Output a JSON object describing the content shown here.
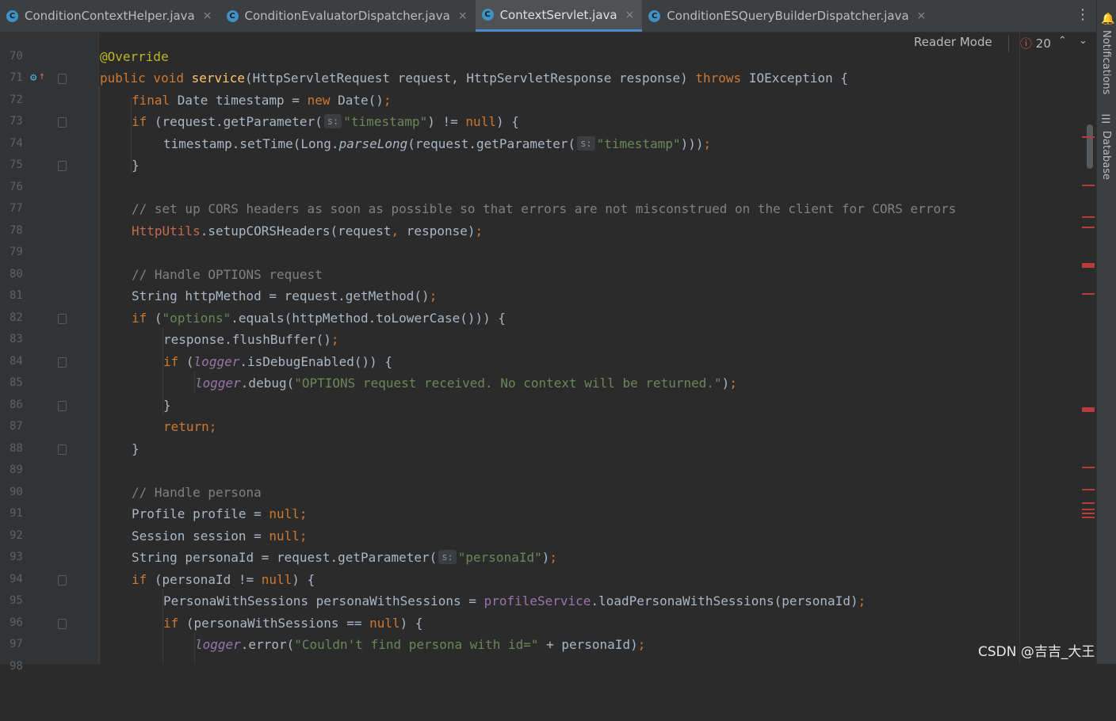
{
  "tabs": [
    {
      "label": "ConditionContextHelper.java",
      "icon": "class-c-icon",
      "active": false
    },
    {
      "label": "ConditionEvaluatorDispatcher.java",
      "icon": "class-c-icon",
      "active": false
    },
    {
      "label": "ContextServlet.java",
      "icon": "class-c-icon",
      "active": true
    },
    {
      "label": "ConditionESQueryBuilderDispatcher.java",
      "icon": "class-c-icon",
      "active": false
    }
  ],
  "tab_close_glyph": "×",
  "tab_icon_glyph": "C",
  "menu_glyph": "⋮",
  "toolbar": {
    "reader_mode": "Reader Mode",
    "error_count": "20",
    "error_glyph": "ⓘ",
    "up_glyph": "⌃",
    "down_glyph": "⌄"
  },
  "side_tools": {
    "notifications": "Notifications",
    "database": "Database"
  },
  "watermark": "CSDN @吉吉_大王",
  "colors": {
    "keyword": "#cc7832",
    "method": "#ffc66d",
    "string": "#6a8759",
    "comment": "#808080",
    "annotation": "#bbb529",
    "field": "#9876aa",
    "error_marker": "#b83b3b"
  },
  "code": {
    "l70": "70",
    "l71": "71",
    "l72": "72",
    "l73": "73",
    "l74": "74",
    "l75": "75",
    "l76": "76",
    "l77": "77",
    "l78": "78",
    "l79": "79",
    "l80": "80",
    "l81": "81",
    "l82": "82",
    "l83": "83",
    "l84": "84",
    "l85": "85",
    "l86": "86",
    "l87": "87",
    "l88": "88",
    "l89": "89",
    "l90": "90",
    "l91": "91",
    "l92": "92",
    "l93": "93",
    "l94": "94",
    "l95": "95",
    "l96": "96",
    "l97": "97",
    "l98": "98",
    "t71_a": "@Override",
    "t72_a": "public void ",
    "t72_b": "service",
    "t72_c": "(HttpServletRequest request, HttpServletResponse response) ",
    "t72_d": "throws ",
    "t72_e": "IOException {",
    "t73_a": "final ",
    "t73_b": "Date timestamp = ",
    "t73_c": "new ",
    "t73_d": "Date()",
    "t73_e": ";",
    "t74_a": "if ",
    "t74_b": "(request.getParameter(",
    "t74_hint": "s:",
    "t74_c": "\"timestamp\"",
    "t74_d": ") != ",
    "t74_e": "null",
    "t74_f": ") {",
    "t75_a": "timestamp.setTime(Long.",
    "t75_b": "parseLong",
    "t75_c": "(request.getParameter(",
    "t75_hint": "s:",
    "t75_d": "\"timestamp\"",
    "t75_e": ")))",
    "t75_f": ";",
    "t76_a": "}",
    "t78_a": "// set up CORS headers as soon as possible so that errors are not misconstrued on the client for CORS errors",
    "t79_a": "HttpUtils",
    "t79_b": ".setupCORSHeaders(request",
    "t79_c": ", ",
    "t79_d": "response)",
    "t79_e": ";",
    "t81_a": "// Handle OPTIONS request",
    "t82_a": "String httpMethod = request.getMethod()",
    "t82_b": ";",
    "t83_a": "if ",
    "t83_b": "(",
    "t83_c": "\"options\"",
    "t83_d": ".equals(httpMethod.toLowerCase())) {",
    "t84_a": "response.flushBuffer()",
    "t84_b": ";",
    "t85_a": "if ",
    "t85_b": "(",
    "t85_c": "logger",
    "t85_d": ".isDebugEnabled()) {",
    "t86_a": "logger",
    "t86_b": ".debug(",
    "t86_c": "\"OPTIONS request received. No context will be returned.\"",
    "t86_d": ")",
    "t86_e": ";",
    "t87_a": "}",
    "t88_a": "return",
    "t88_b": ";",
    "t89_a": "}",
    "t91_a": "// Handle persona",
    "t92_a": "Profile profile = ",
    "t92_b": "null",
    "t92_c": ";",
    "t93_a": "Session session = ",
    "t93_b": "null",
    "t93_c": ";",
    "t94_a": "String personaId = request.getParameter(",
    "t94_hint": "s:",
    "t94_b": "\"personaId\"",
    "t94_c": ")",
    "t94_d": ";",
    "t95_a": "if ",
    "t95_b": "(personaId != ",
    "t95_c": "null",
    "t95_d": ") {",
    "t96_a": "PersonaWithSessions personaWithSessions = ",
    "t96_b": "profileService",
    "t96_c": ".loadPersonaWithSessions(personaId)",
    "t96_d": ";",
    "t97_a": "if ",
    "t97_b": "(personaWithSessions == ",
    "t97_c": "null",
    "t97_d": ") {",
    "t98_a": "logger",
    "t98_b": ".error(",
    "t98_c": "\"Couldn't find persona with id=\"",
    "t98_d": " + personaId)",
    "t98_e": ";"
  }
}
